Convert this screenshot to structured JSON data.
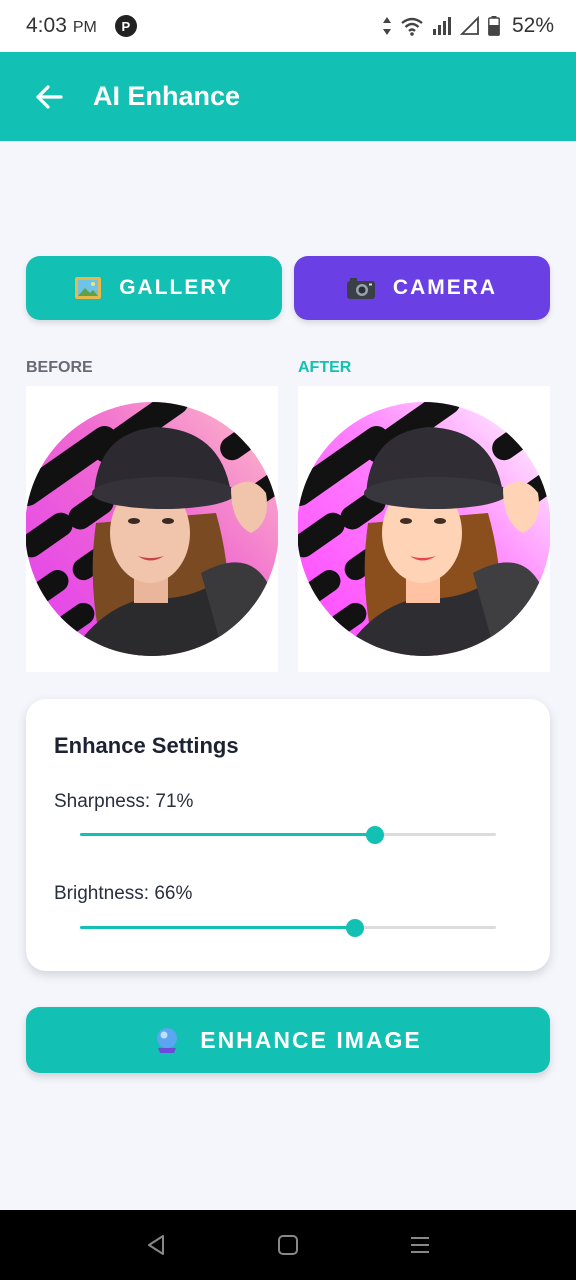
{
  "status_bar": {
    "time": "4:03",
    "ampm": "PM",
    "notification_glyph": "P",
    "battery": "52%"
  },
  "app_bar": {
    "title": "AI Enhance"
  },
  "source_buttons": {
    "gallery_label": "GALLERY",
    "camera_label": "CAMERA"
  },
  "comparison": {
    "before_label": "BEFORE",
    "after_label": "AFTER"
  },
  "settings": {
    "title": "Enhance Settings",
    "sharpness_label": "Sharpness: 71%",
    "sharpness_value": 0.71,
    "brightness_label": "Brightness: 66%",
    "brightness_value": 0.66
  },
  "enhance_button": {
    "label": "ENHANCE IMAGE"
  },
  "colors": {
    "primary": "#12c1b3",
    "camera": "#6a3fe4",
    "background": "#f4f6fc",
    "title_text": "#1d2233"
  },
  "icons": {
    "back": "arrow-left-icon",
    "gallery": "picture-frame-icon",
    "camera": "camera-icon",
    "enhance": "crystal-ball-icon",
    "nav_back": "triangle-back-icon",
    "nav_home": "square-home-icon",
    "nav_menu": "menu-lines-icon"
  }
}
